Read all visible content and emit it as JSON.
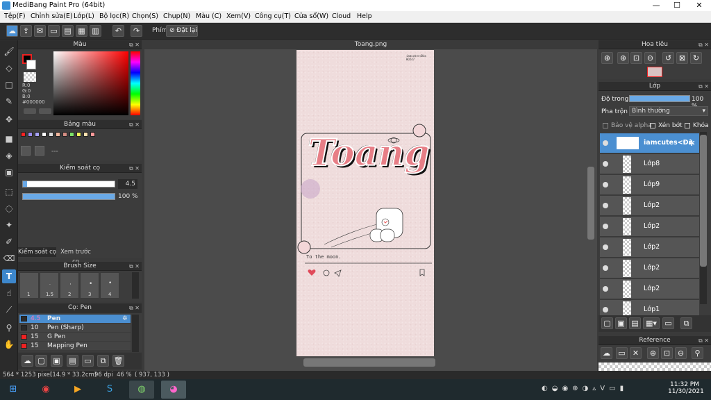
{
  "window": {
    "title": "MediBang Paint Pro (64bit)",
    "minimize": "—",
    "maximize": "☐",
    "close": "✕"
  },
  "menu": [
    "Tệp(F)",
    "Chỉnh sửa(E)",
    "Lớp(L)",
    "Bộ lọc(R)",
    "Chọn(S)",
    "Chụp(N)",
    "Màu (C)",
    "Xem(V)",
    "Công cụ(T)",
    "Cửa sổ(W)",
    "Cloud",
    "Help"
  ],
  "toolbar": {
    "keys_label": "Phím",
    "reset_label": "Đặt lại"
  },
  "color_panel": {
    "title": "Màu",
    "r": "R:0",
    "g": "G:0",
    "b": "B:0",
    "hex": "#000000"
  },
  "palette_panel": {
    "title": "Bảng màu",
    "placeholder": "---",
    "swatches": [
      "#ff2222",
      "#9b8cf0",
      "#a6a2f6",
      "#ffffff",
      "#dddddd",
      "#f2b79e",
      "#d58e84",
      "#7ee36a",
      "#f2f55a",
      "#ffe0b0",
      "#ff9999"
    ]
  },
  "brush_control": {
    "title": "Kiểm soát cọ",
    "size": "4.5",
    "opacity": "100 %",
    "size_fill": 0.04,
    "tab1": "Kiểm soát cọ",
    "tab2": "Xem trước cọ"
  },
  "brush_size": {
    "title": "Brush Size",
    "sizes": [
      "1",
      "1.5",
      "2",
      "3",
      "4"
    ]
  },
  "brush_list": {
    "title": "Cọ: Pen",
    "items": [
      {
        "size": "4.5",
        "name": "Pen",
        "color": "#2b2b2b",
        "selected": true
      },
      {
        "size": "10",
        "name": "Pen (Sharp)",
        "color": "#2b2b2b",
        "selected": false
      },
      {
        "size": "15",
        "name": "G Pen",
        "color": "#ee2222",
        "selected": false
      },
      {
        "size": "15",
        "name": "Mapping Pen",
        "color": "#ee2222",
        "selected": false
      }
    ]
  },
  "document": {
    "tab": "Toang.png",
    "art_title": "Toang",
    "caption": "To the moon.",
    "watermark_1": "iamcutes<Đào",
    "watermark_2": "HD247"
  },
  "navigator": {
    "title": "Hoa tiêu"
  },
  "layer_panel": {
    "title": "Lớp",
    "opacity_label": "Độ trong",
    "opacity_value": "100 %",
    "blend_label": "Pha trộn",
    "blend_value": "Bình thường",
    "protect_alpha": "Bảo vệ alpha",
    "clip": "Xén bớt",
    "lock": "Khóa",
    "layers": [
      {
        "name": "iamcutes<Đà",
        "selected": true
      },
      {
        "name": "Lớp8",
        "selected": false
      },
      {
        "name": "Lớp9",
        "selected": false
      },
      {
        "name": "Lớp2",
        "selected": false
      },
      {
        "name": "Lớp2",
        "selected": false
      },
      {
        "name": "Lớp2",
        "selected": false
      },
      {
        "name": "Lớp2",
        "selected": false
      },
      {
        "name": "Lớp2",
        "selected": false
      },
      {
        "name": "Lớp1",
        "selected": false
      }
    ]
  },
  "reference_panel": {
    "title": "Reference"
  },
  "status": {
    "size": "564 * 1253 pixel",
    "cm": "(14.9 * 33.2cm)",
    "dpi": "96 dpi",
    "zoom": "46 %",
    "coords": "( 937, 133 )"
  },
  "taskbar": {
    "time": "11:32 PM",
    "date": "11/30/2021"
  }
}
